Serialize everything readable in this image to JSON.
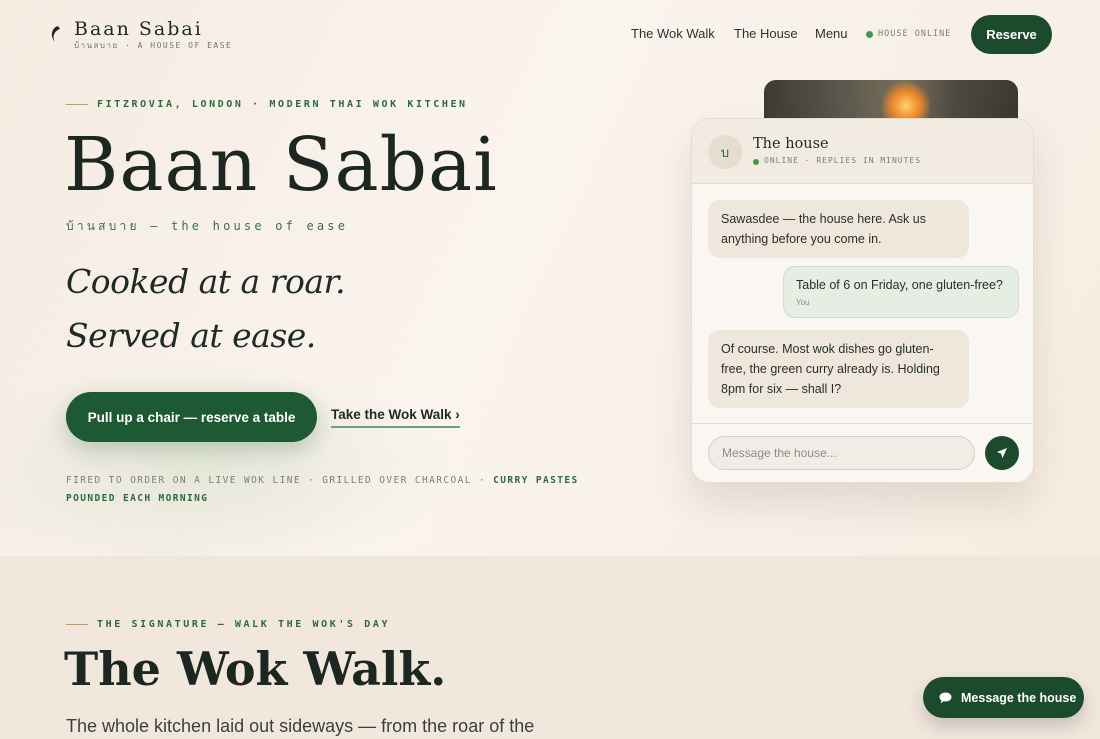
{
  "nav": {
    "brand": "Baan Sabai",
    "brand_sub": "บ้านสบาย · A HOUSE OF EASE",
    "links": [
      "The Wok Walk",
      "The House",
      "Menu"
    ],
    "status": "HOUSE ONLINE",
    "reserve_label": "Reserve"
  },
  "hero": {
    "eyebrow": "FITZROVIA, LONDON · MODERN THAI WOK KITCHEN",
    "title": "Baan Sabai",
    "thai_line": "บ้านสบาย — the house of ease",
    "tagline_1": "Cooked at a roar.",
    "tagline_2": "Served at ease.",
    "cta_label": "Pull up a chair — reserve a table",
    "walk_label": "Take the Wok Walk ›",
    "fired_plain": "FIRED TO ORDER ON A LIVE WOK LINE · GRILLED OVER CHARCOAL · ",
    "fired_strong": "CURRY PASTES POUNDED EACH MORNING"
  },
  "chat": {
    "avatar_letter": "บ",
    "title": "The house",
    "status": "ONLINE · REPLIES IN MINUTES",
    "messages": [
      {
        "from": "house",
        "text": "Sawasdee — the house here. Ask us anything before you come in."
      },
      {
        "from": "you",
        "text": "Table of 6 on Friday, one gluten-free?",
        "label": "You"
      },
      {
        "from": "house",
        "text": "Of course. Most wok dishes go gluten-free, the green curry already is. Holding 8pm for six — shall I?"
      }
    ],
    "input_placeholder": "Message the house...",
    "send_icon": "send-icon"
  },
  "signature": {
    "eyebrow": "THE SIGNATURE — WALK THE WOK'S DAY",
    "title": "The Wok Walk.",
    "desc": "The whole kitchen laid out sideways — from the roar of the"
  },
  "fab": {
    "label": "Message the house",
    "icon": "chat-bubble-icon"
  },
  "colors": {
    "brand_green": "#1c4a2c",
    "accent_gold": "#c49a5f",
    "online_green": "#3e9a52",
    "background": "#f7efe7"
  }
}
